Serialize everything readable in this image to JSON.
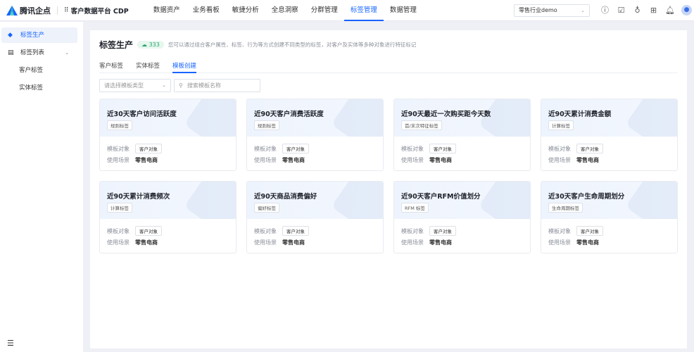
{
  "header": {
    "brand": "腾讯企点",
    "product": "客户数据平台 CDP",
    "nav": [
      {
        "label": "数据资产"
      },
      {
        "label": "业务看板"
      },
      {
        "label": "敏捷分析"
      },
      {
        "label": "全息洞察"
      },
      {
        "label": "分群管理"
      },
      {
        "label": "标签管理",
        "active": true
      },
      {
        "label": "数据管理"
      }
    ],
    "tenant": "零售行业demo",
    "icons": [
      "help-icon",
      "clipboard-check-icon",
      "key-icon",
      "apps-grid-icon",
      "bell-icon",
      "avatar"
    ]
  },
  "sidebar": {
    "items": [
      {
        "label": "标签生产",
        "active": true
      },
      {
        "label": "标签列表"
      },
      {
        "label": "客户标签"
      },
      {
        "label": "实体标签"
      }
    ]
  },
  "main": {
    "title": "标签生产",
    "count": "333",
    "description": "您可以通过组合客户属性、标签、行为等方式创建不同类型的标签，对客户及实体等多种对象进行特征标记",
    "tabs": [
      {
        "label": "客户标签"
      },
      {
        "label": "实体标签"
      },
      {
        "label": "模板创建",
        "active": true
      }
    ],
    "filter_placeholder": "请选择模板类型",
    "search_placeholder": "搜索模板名称",
    "label_object": "模板对象",
    "label_scene": "使用场景",
    "cards": [
      {
        "title": "近30天客户访问活跃度",
        "tag": "规则标签",
        "object": "客户对象",
        "scene": "零售电商"
      },
      {
        "title": "近90天客户消费活跃度",
        "tag": "规则标签",
        "object": "客户对象",
        "scene": "零售电商"
      },
      {
        "title": "近90天最近一次购买距今天数",
        "tag": "首/末次特征标签",
        "object": "客户对象",
        "scene": "零售电商"
      },
      {
        "title": "近90天累计消费金额",
        "tag": "计算标签",
        "object": "客户对象",
        "scene": "零售电商"
      },
      {
        "title": "近90天累计消费频次",
        "tag": "计算标签",
        "object": "客户对象",
        "scene": "零售电商"
      },
      {
        "title": "近90天商品消费偏好",
        "tag": "偏好标签",
        "object": "客户对象",
        "scene": "零售电商"
      },
      {
        "title": "近90天客户RFM价值划分",
        "tag": "RFM 标签",
        "object": "客户对象",
        "scene": "零售电商"
      },
      {
        "title": "近30天客户生命周期划分",
        "tag": "生命周期标签",
        "object": "客户对象",
        "scene": "零售电商"
      }
    ]
  },
  "colors": {
    "accent": "#1664ff",
    "badge": "#2ba471"
  }
}
